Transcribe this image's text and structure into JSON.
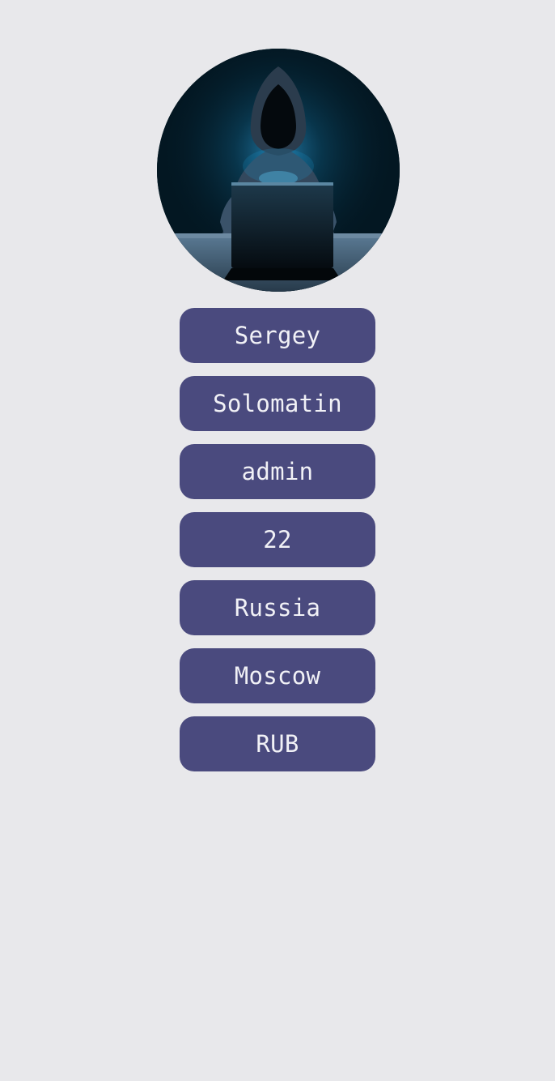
{
  "profile": {
    "avatar_icon": "hooded-hacker-avatar",
    "fields": [
      "Sergey",
      "Solomatin",
      "admin",
      "22",
      "Russia",
      "Moscow",
      "RUB"
    ]
  },
  "colors": {
    "background": "#e8e8eb",
    "field_background": "#4a4a7e",
    "field_text": "#f1f1f6"
  }
}
